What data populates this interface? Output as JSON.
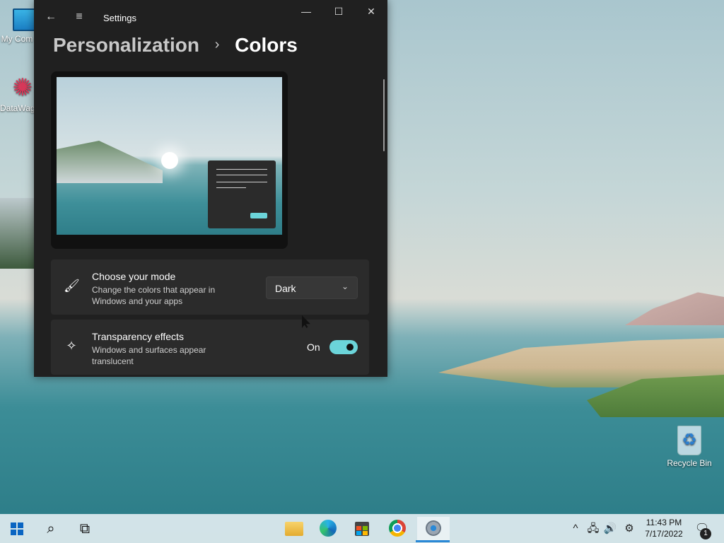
{
  "desktop": {
    "icons": [
      {
        "label": "My Com",
        "icon": "computer-icon"
      },
      {
        "label": "DataWag",
        "icon": "datawagon-icon"
      },
      {
        "label": "Recycle Bin",
        "icon": "recycle-bin-icon"
      }
    ]
  },
  "window": {
    "title": "Settings",
    "back_icon": "back-arrow-icon",
    "menu_icon": "hamburger-menu-icon",
    "controls": {
      "minimize": "—",
      "maximize": "☐",
      "close": "✕"
    }
  },
  "breadcrumb": {
    "parent": "Personalization",
    "separator": "›",
    "current": "Colors"
  },
  "settings": {
    "mode": {
      "title": "Choose your mode",
      "description": "Change the colors that appear in Windows and your apps",
      "selected": "Dark",
      "icon": "paintbrush-icon"
    },
    "transparency": {
      "title": "Transparency effects",
      "description": "Windows and surfaces appear translucent",
      "state_label": "On",
      "enabled": true,
      "icon": "sparkle-icon"
    }
  },
  "accent_color": "#6bd4d9",
  "taskbar": {
    "items": [
      "start-icon",
      "search-icon",
      "task-view-icon",
      "file-explorer-icon",
      "edge-icon",
      "store-icon",
      "chrome-icon",
      "settings-icon"
    ],
    "active": "settings-icon"
  },
  "tray": {
    "time": "11:43 PM",
    "date": "7/17/2022",
    "notification_count": "1"
  }
}
